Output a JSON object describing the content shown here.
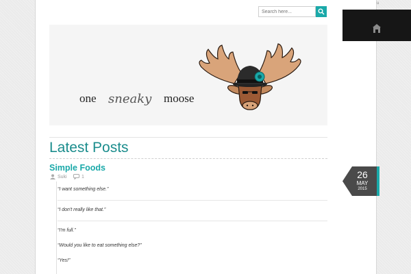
{
  "search": {
    "placeholder": "Search here..."
  },
  "banner": {
    "tagline": [
      "one",
      "sneaky",
      "moose"
    ]
  },
  "section": {
    "title": "Latest Posts"
  },
  "post": {
    "title": "Simple Foods",
    "author": "Suki",
    "comments": "1",
    "date": {
      "day": "26",
      "month": "MAY",
      "year": "2015"
    },
    "quotes": [
      "“I want something else.”",
      "“I don't really like that.”",
      "“I'm full.”",
      "“Would you like to eat something else?”",
      "“Yes!”"
    ]
  },
  "colors": {
    "accent": "#1aa9a9",
    "title": "#1a8c8c",
    "badge": "#4a4a4a"
  },
  "icons": {
    "search": "search-icon",
    "author": "user-icon",
    "comments": "comment-icon",
    "home": "home-icon"
  }
}
